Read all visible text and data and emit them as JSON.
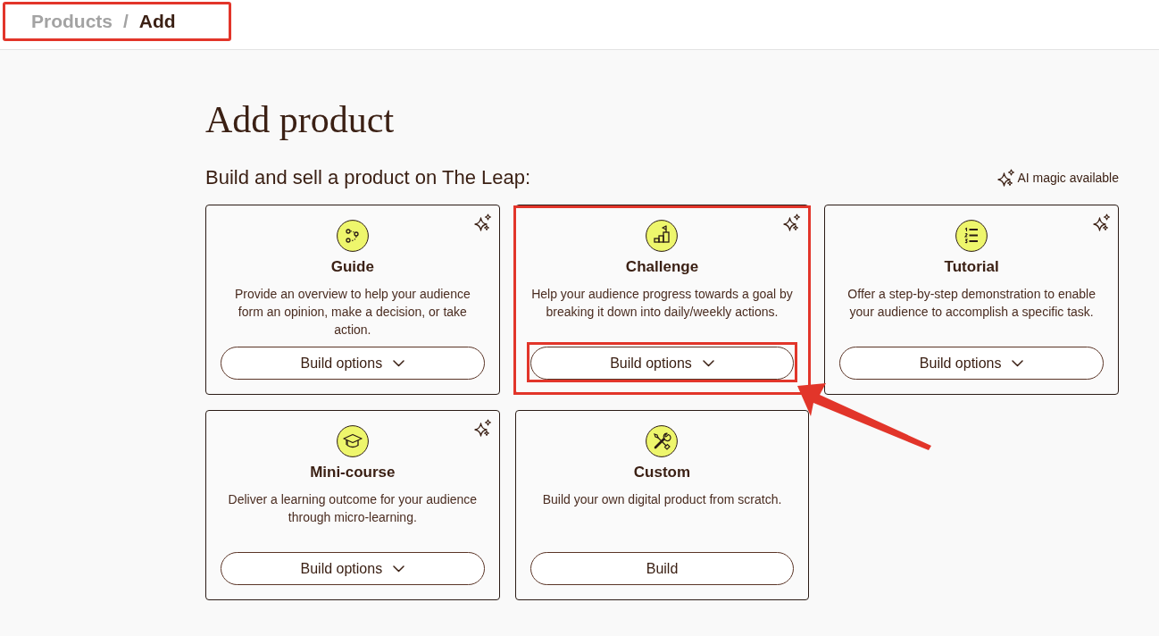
{
  "breadcrumb": {
    "highlighted": true,
    "separator": "/",
    "items": [
      {
        "label": "Products",
        "current": false
      },
      {
        "label": "Add",
        "current": true
      }
    ]
  },
  "title": "Add product",
  "subtitle": "Build and sell a product on The Leap:",
  "ai_legend": {
    "label": "AI magic available"
  },
  "cards": [
    {
      "title": "Guide",
      "description": "Provide an overview to help your audience form an opinion, make a decision, or take action.",
      "ai_magic": true,
      "highlighted": false,
      "button": {
        "label": "Build options",
        "dropdown": true,
        "highlighted": false,
        "arrow": false
      }
    },
    {
      "title": "Challenge",
      "description": "Help your audience progress towards a goal by breaking it down into daily/weekly actions.",
      "ai_magic": true,
      "highlighted": true,
      "button": {
        "label": "Build options",
        "dropdown": true,
        "highlighted": true,
        "arrow": true
      }
    },
    {
      "title": "Tutorial",
      "description": "Offer a step-by-step demonstration to enable your audience to accomplish a specific task.",
      "ai_magic": true,
      "highlighted": false,
      "button": {
        "label": "Build options",
        "dropdown": true,
        "highlighted": false,
        "arrow": false
      }
    },
    {
      "title": "Mini-course",
      "description": "Deliver a learning outcome for your audience through micro-learning.",
      "ai_magic": true,
      "highlighted": false,
      "button": {
        "label": "Build options",
        "dropdown": true,
        "highlighted": false,
        "arrow": false
      }
    },
    {
      "title": "Custom",
      "description": "Build your own digital product from scratch.",
      "ai_magic": false,
      "highlighted": false,
      "button": {
        "label": "Build",
        "dropdown": false,
        "highlighted": false,
        "arrow": false
      }
    }
  ]
}
